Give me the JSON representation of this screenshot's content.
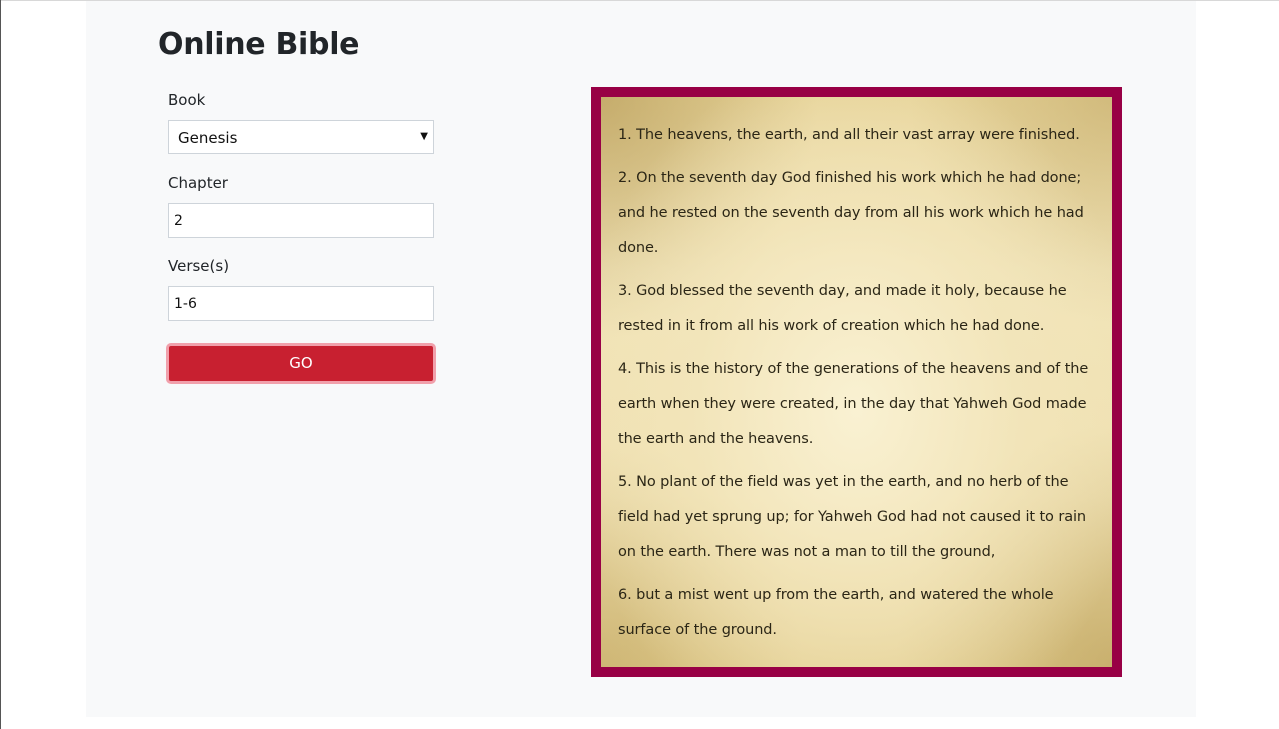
{
  "page": {
    "title": "Online Bible"
  },
  "form": {
    "book_label": "Book",
    "book_value": "Genesis",
    "chapter_label": "Chapter",
    "chapter_value": "2",
    "verses_label": "Verse(s)",
    "verses_value": "1-6",
    "go_label": "GO"
  },
  "passage": {
    "verses": [
      "1. The heavens, the earth, and all their vast array were finished.",
      "2. On the seventh day God finished his work which he had done; and he rested on the seventh day from all his work which he had done.",
      "3. God blessed the seventh day, and made it holy, because he rested in it from all his work of creation which he had done.",
      "4. This is the history of the generations of the heavens and of the earth when they were created, in the day that Yahweh God made the earth and the heavens.",
      "5. No plant of the field was yet in the earth, and no herb of the field had yet sprung up; for Yahweh God had not caused it to rain on the earth. There was not a man to till the ground,",
      "6. but a mist went up from the earth, and watered the whole surface of the ground."
    ]
  },
  "colors": {
    "button": "#c82030",
    "frame_border": "#980045",
    "page_background": "#f8f9fa"
  },
  "icons": {
    "select_caret": "caret-down-icon"
  }
}
